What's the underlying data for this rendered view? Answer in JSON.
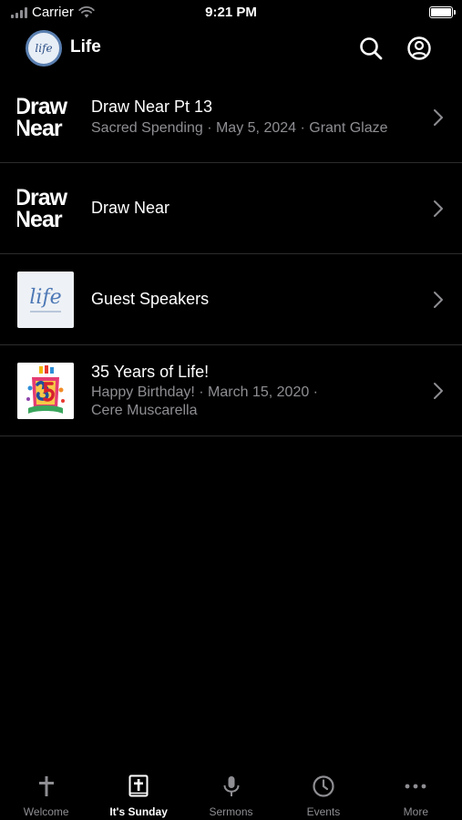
{
  "status_bar": {
    "carrier": "Carrier",
    "time": "9:21 PM"
  },
  "header": {
    "title": "Life",
    "logo_text": "life"
  },
  "items": [
    {
      "thumb_line1": "Draw",
      "thumb_line2": "Near",
      "title": "Draw Near Pt 13",
      "subtitle_line1": "Sacred Spending · May 5, 2024 · Grant Glaze",
      "subtitle_line2": ""
    },
    {
      "thumb_line1": "Draw",
      "thumb_line2": "Near",
      "title": "Draw Near",
      "subtitle_line1": "",
      "subtitle_line2": ""
    },
    {
      "thumb_script": "life",
      "title": "Guest Speakers",
      "subtitle_line1": "",
      "subtitle_line2": ""
    },
    {
      "title": "35 Years of Life!",
      "subtitle_line1": "Happy Birthday! · March 15, 2020 ·",
      "subtitle_line2": "Cere Muscarella"
    }
  ],
  "tabs": [
    {
      "label": "Welcome",
      "icon": "cross-icon",
      "active": false
    },
    {
      "label": "It's Sunday",
      "icon": "bible-icon",
      "active": true
    },
    {
      "label": "Sermons",
      "icon": "microphone-icon",
      "active": false
    },
    {
      "label": "Events",
      "icon": "clock-icon",
      "active": false
    },
    {
      "label": "More",
      "icon": "more-dots-icon",
      "active": false
    }
  ],
  "colors": {
    "background": "#000000",
    "text": "#ffffff",
    "secondary_text": "#8e8e93",
    "separator": "#2c2c2e",
    "accent_logo": "#4d78b6"
  }
}
